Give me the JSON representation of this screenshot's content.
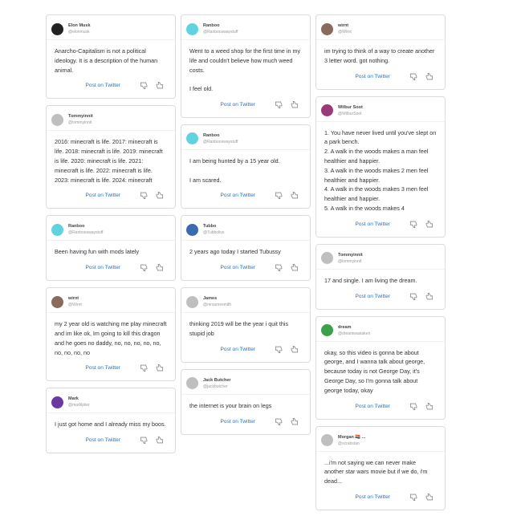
{
  "post_label": "Post on Twitter",
  "columns": [
    [
      {
        "name": "Elon Musk",
        "handle": "@elonmusk",
        "avatar": "#222222",
        "text": "Anarcho-Capitalism is not a political ideology. It is a description of the human animal."
      },
      {
        "name": "Tommyinnit",
        "handle": "@tommyinnit",
        "avatar": "#bfbfbf",
        "text": "2016: minecraft is life. 2017: minecraft is life. 2018: minecraft is life. 2019: minecraft is life. 2020: minecraft is life. 2021: minecraft is life. 2022: minecraft is life. 2023: minecraft is life. 2024: minecraft"
      },
      {
        "name": "Ranboo",
        "handle": "@Ranbooswaystuff",
        "avatar": "#5fd4e0",
        "text": "Been having fun with mods lately"
      },
      {
        "name": "wirnt",
        "handle": "@Wirnt",
        "avatar": "#8a6a5a",
        "text": "my 2 year old is watching me play minecraft and im like ok, Im going to kill this dragon and he goes no daddy, no, no, no, no, no, no, no, no, no"
      },
      {
        "name": "Mark",
        "handle": "@markiplier",
        "avatar": "#6a3aa0",
        "text": "I just got home and I already miss my boos."
      }
    ],
    [
      {
        "name": "Ranboo",
        "handle": "@Ranbooswaystuff",
        "avatar": "#5fd4e0",
        "text": "Went to a weed shop for the first time in my life and couldn't believe how much weed costs.\n\nI feel old."
      },
      {
        "name": "Ranboo",
        "handle": "@Ranbooswaystuff",
        "avatar": "#5fd4e0",
        "text": "I am being hunted by a 15 year old.\n\nI am scared."
      },
      {
        "name": "Tubbo",
        "handle": "@Tubbolive",
        "avatar": "#3a6ab0",
        "text": "2 years ago today I started Tubussy"
      },
      {
        "name": "James",
        "handle": "@mrsamesmith",
        "avatar": "#bfbfbf",
        "text": "thinking 2019 will be the year i quit this stupid job"
      },
      {
        "name": "Jack Butcher",
        "handle": "@jackbutcher",
        "avatar": "#bfbfbf",
        "text": "the internet is your brain on legs"
      }
    ],
    [
      {
        "name": "wirnt",
        "handle": "@Wirnt",
        "avatar": "#8a6a5a",
        "text": "im trying to think of a way to create another 3 letter word. got nothing."
      },
      {
        "name": "Wilbur Soot",
        "handle": "@WilburSoot",
        "avatar": "#9a3a7a",
        "text": "1. You have never lived until you've slept on a park bench.\n2. A walk in the woods makes a man feel healthier and happier.\n3. A walk in the woods makes 2 men feel healthier and happier.\n4. A walk in the woods makes 3 men feel healthier and happier.\n5. A walk in the woods makes 4"
      },
      {
        "name": "Tommyinnit",
        "handle": "@tommyinnit",
        "avatar": "#bfbfbf",
        "text": "17 and single. I am living the dream."
      },
      {
        "name": "dream",
        "handle": "@dreamwastaken",
        "avatar": "#3aa04a",
        "text": "okay, so this video is gonna be about george, and I wanna talk about george, because today is not George Day, it's George Day, so I'm gonna talk about george today, okay"
      },
      {
        "name": "Morgan 🏳️‍🌈 ...",
        "handle": "@scrabstan",
        "avatar": "#bfbfbf",
        "text": "...i'm not saying we can never make another star wars movie but if we do, i'm dead..."
      }
    ]
  ]
}
